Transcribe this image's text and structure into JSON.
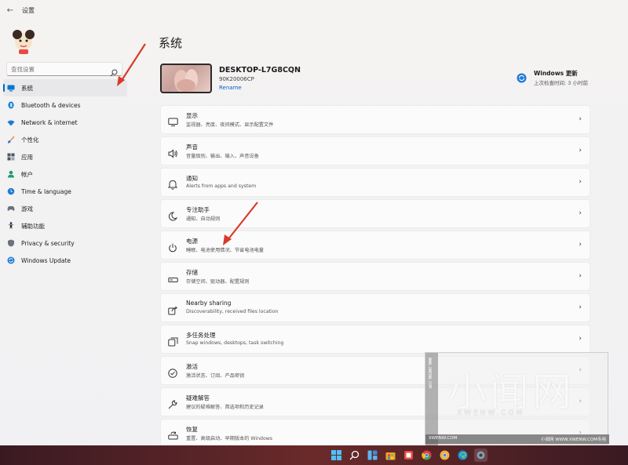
{
  "window": {
    "title": "设置"
  },
  "sidebar": {
    "search_placeholder": "查找设置",
    "items": [
      {
        "label": "系统",
        "icon": "monitor-icon",
        "active": true
      },
      {
        "label": "Bluetooth & devices",
        "icon": "bluetooth-icon"
      },
      {
        "label": "Network & internet",
        "icon": "wifi-icon"
      },
      {
        "label": "个性化",
        "icon": "brush-icon"
      },
      {
        "label": "应用",
        "icon": "apps-icon"
      },
      {
        "label": "帐户",
        "icon": "person-icon"
      },
      {
        "label": "Time & language",
        "icon": "globe-clock-icon"
      },
      {
        "label": "游戏",
        "icon": "gamepad-icon"
      },
      {
        "label": "辅助功能",
        "icon": "accessibility-icon"
      },
      {
        "label": "Privacy & security",
        "icon": "shield-icon"
      },
      {
        "label": "Windows Update",
        "icon": "update-icon"
      }
    ]
  },
  "main": {
    "title": "系统",
    "device": {
      "name": "DESKTOP-L7G8CQN",
      "model": "90K20006CP",
      "rename": "Rename"
    },
    "update": {
      "title": "Windows 更新",
      "subtitle": "上次检查时间: 3 小时前"
    },
    "settings": [
      {
        "title": "显示",
        "subtitle": "监视器、亮度、夜间模式、显示配置文件",
        "icon": "display-icon"
      },
      {
        "title": "声音",
        "subtitle": "音量级别、输出、输入、声音设备",
        "icon": "speaker-icon"
      },
      {
        "title": "通知",
        "subtitle": "Alerts from apps and system",
        "icon": "bell-icon"
      },
      {
        "title": "专注助手",
        "subtitle": "通知、自动规则",
        "icon": "moon-icon"
      },
      {
        "title": "电源",
        "subtitle": "睡眠、电池使用情况、节省电池电量",
        "icon": "power-icon"
      },
      {
        "title": "存储",
        "subtitle": "存储空间、驱动器、配置规则",
        "icon": "storage-icon"
      },
      {
        "title": "Nearby sharing",
        "subtitle": "Discoverability, received files location",
        "icon": "share-icon"
      },
      {
        "title": "多任务处理",
        "subtitle": "Snap windows, desktops, task switching",
        "icon": "multitask-icon"
      },
      {
        "title": "激活",
        "subtitle": "激活状态、订阅、产品密钥",
        "icon": "check-circle-icon"
      },
      {
        "title": "疑难解答",
        "subtitle": "建议的疑难解答、首选项和历史记录",
        "icon": "wrench-icon"
      },
      {
        "title": "恢复",
        "subtitle": "重置、高级启动、早期版本的 Windows",
        "icon": "recovery-icon"
      }
    ]
  },
  "watermark": {
    "main": "小闻网",
    "sub": "XWENW.COM",
    "side": "WWW.XWENW.COM",
    "bar_left": "XWENW.COM",
    "bar_right": "小闻网 WWW.XWENW.COM专用"
  },
  "taskbar": {
    "icons": [
      "windows-start-icon",
      "search-icon",
      "widgets-icon",
      "store-icon",
      "office-icon",
      "chrome-icon",
      "chrome-canary-icon",
      "edge-icon",
      "settings-icon"
    ]
  },
  "colors": {
    "accent": "#0067c0",
    "annotation": "#d93a2b"
  }
}
